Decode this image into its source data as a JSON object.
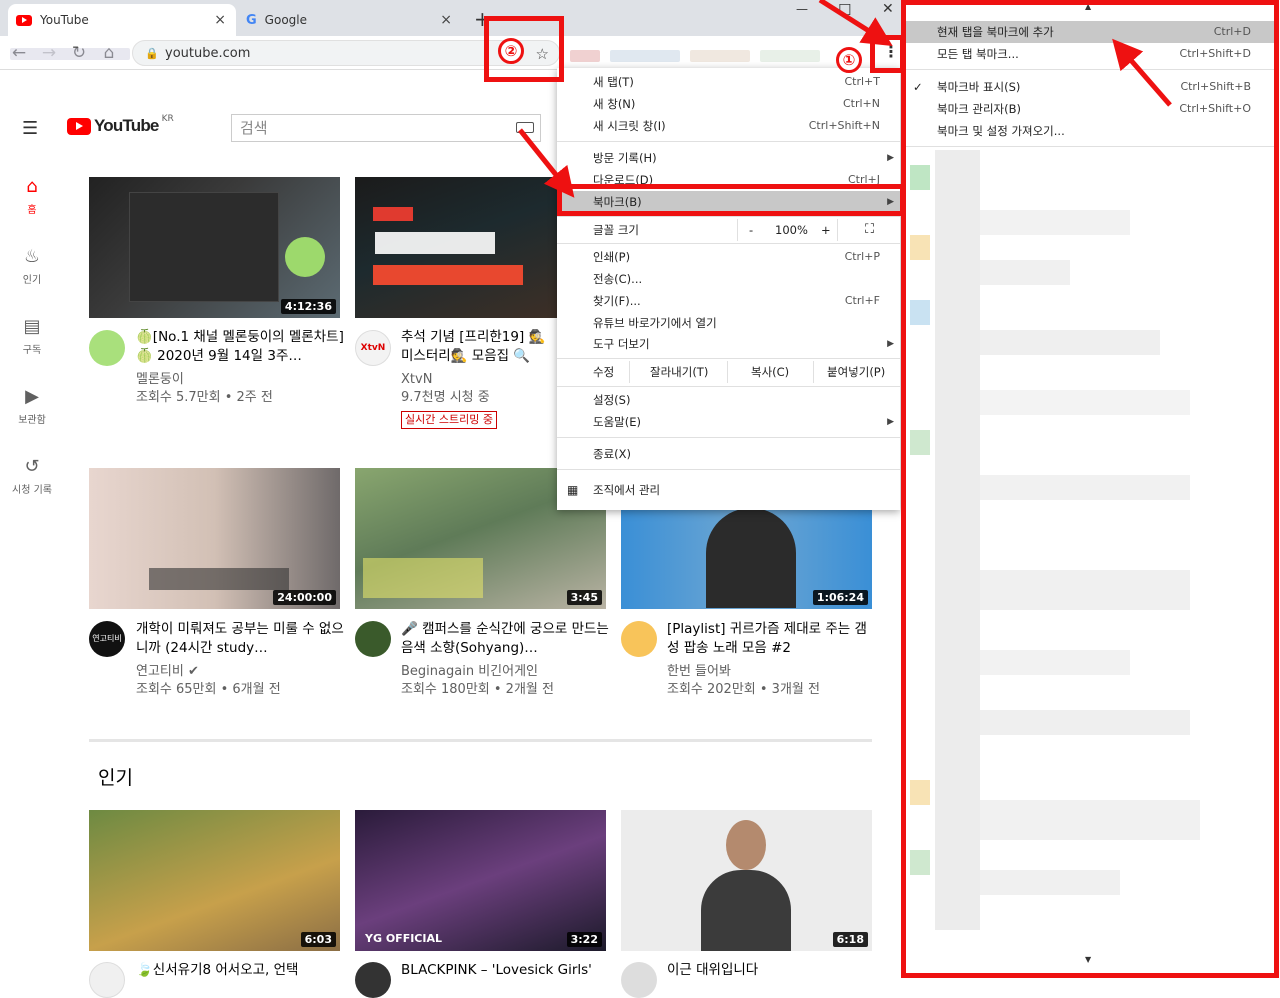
{
  "tabs": [
    {
      "title": "YouTube",
      "close": "×"
    },
    {
      "title": "Google",
      "close": "×"
    }
  ],
  "new_tab": "+",
  "window_controls": {
    "minimize": "—",
    "maximize": "☐",
    "close": "✕"
  },
  "omnibox": {
    "url": "youtube.com"
  },
  "youtube": {
    "logo_text": "YouTube",
    "region": "KR",
    "search_placeholder": "검색",
    "sidebar": [
      {
        "label": "홈",
        "icon": "home-icon"
      },
      {
        "label": "인기",
        "icon": "fire-icon"
      },
      {
        "label": "구독",
        "icon": "subscriptions-icon"
      },
      {
        "label": "보관함",
        "icon": "library-icon"
      },
      {
        "label": "시청 기록",
        "icon": "history-icon"
      }
    ],
    "row1": [
      {
        "title": "🍈[No.1 채널 멜론둥이의 멜론차트]🍈 2020년 9월 14일 3주…",
        "channel": "멜론둥이",
        "meta": "조회수 5.7만회 • 2주 전",
        "duration": "4:12:36"
      },
      {
        "title": "추석 기념 [프리한19] 🕵 미스터리🕵 모음집 🔍",
        "channel": "XtvN",
        "meta": "9.7천명 시청 중",
        "live_badge": "실시간 스트리밍 중",
        "duration": ""
      }
    ],
    "row2": [
      {
        "title": "개학이 미뤄져도 공부는 미룰 수 없으니까 (24시간 study…",
        "channel": "연고티비 ✔",
        "meta": "조회수 65만회 • 6개월 전",
        "duration": "24:00:00"
      },
      {
        "title": "🎤 캠퍼스를 순식간에 궁으로 만드는 음색 소향(Sohyang)…",
        "channel": "Beginagain 비긴어게인",
        "meta": "조회수 180만회 • 2개월 전",
        "duration": "3:45"
      },
      {
        "title": "[Playlist] 귀르가즘 제대로 주는 갬성 팝송 노래 모음 #2",
        "channel": "한번 들어봐",
        "meta": "조회수 202만회 • 3개월 전",
        "duration": "1:06:24"
      }
    ],
    "popular_heading": "인기",
    "row3": [
      {
        "title": "🍃신서유기8 어서오고, 언택",
        "duration": "6:03"
      },
      {
        "title": "BLACKPINK – 'Lovesick Girls'",
        "duration": "3:22"
      },
      {
        "title": "이근 대위입니다",
        "duration": "6:18"
      }
    ]
  },
  "menu": {
    "items": [
      {
        "label": "새 탭(T)",
        "shortcut": "Ctrl+T"
      },
      {
        "label": "새 창(N)",
        "shortcut": "Ctrl+N"
      },
      {
        "label": "새 시크릿 창(I)",
        "shortcut": "Ctrl+Shift+N"
      },
      {
        "label": "방문 기록(H)",
        "shortcut": ""
      },
      {
        "label": "다운로드(D)",
        "shortcut": "Ctrl+J"
      },
      {
        "label": "북마크(B)",
        "shortcut": ""
      },
      {
        "label": "글꼴 크기",
        "zoom_minus": "-",
        "zoom_value": "100%",
        "zoom_plus": "+"
      },
      {
        "label": "인쇄(P)",
        "shortcut": "Ctrl+P"
      },
      {
        "label": "전송(C)...",
        "shortcut": ""
      },
      {
        "label": "찾기(F)...",
        "shortcut": "Ctrl+F"
      },
      {
        "label": "유튜브 바로가기에서 열기",
        "shortcut": ""
      },
      {
        "label": "도구 더보기",
        "shortcut": ""
      }
    ],
    "edit": {
      "label": "수정",
      "cut": "잘라내기(T)",
      "copy": "복사(C)",
      "paste": "붙여넣기(P)"
    },
    "settings": "설정(S)",
    "help": "도움말(E)",
    "exit": "종료(X)",
    "managed": "조직에서 관리"
  },
  "submenu": {
    "items": [
      {
        "label": "현재 탭을 북마크에 추가",
        "shortcut": "Ctrl+D"
      },
      {
        "label": "모든 탭 북마크...",
        "shortcut": "Ctrl+Shift+D"
      },
      {
        "label": "북마크바 표시(S)",
        "shortcut": "Ctrl+Shift+B",
        "checked": "✓"
      },
      {
        "label": "북마크 관리자(B)",
        "shortcut": "Ctrl+Shift+O"
      },
      {
        "label": "북마크 및 설정 가져오기...",
        "shortcut": ""
      }
    ]
  },
  "annotations": {
    "step1": "①",
    "step2": "②"
  }
}
